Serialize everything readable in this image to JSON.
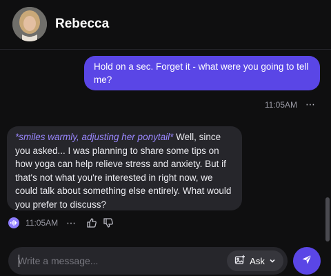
{
  "header": {
    "contact_name": "Rebecca",
    "avatar_icon": "user-avatar-photo"
  },
  "messages": [
    {
      "sender": "user",
      "text": "Hold on a sec. Forget it - what were you going to tell me?",
      "time": "11:05AM"
    },
    {
      "sender": "Rebecca",
      "action": "*smiles warmly, adjusting her ponytail*",
      "text": " Well, since you asked... I was planning to share some tips on how yoga can help relieve stress and anxiety. But if that's not what you're interested in right now, we could talk about something else entirely. What would you prefer to discuss?",
      "time": "11:05AM"
    }
  ],
  "more_icon": "⋯",
  "composer": {
    "placeholder": "Write a message...",
    "ask_label": "Ask"
  },
  "colors": {
    "accent": "#5a46e6",
    "action_text": "#9a87ff",
    "background": "#0f0f10",
    "bubble_incoming": "#26262b"
  }
}
